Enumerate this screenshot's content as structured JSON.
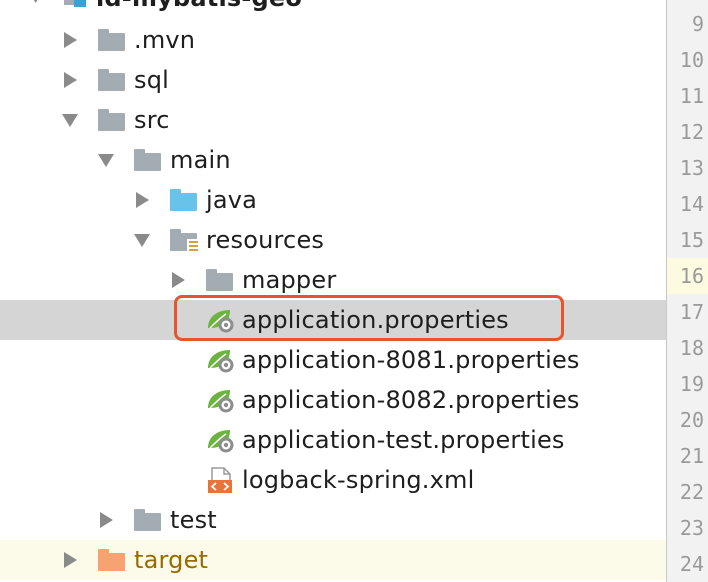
{
  "project": {
    "root_label": "ld-mybatis-geo"
  },
  "tree": [
    {
      "label": ".mvn",
      "kind": "folder-gray",
      "arrow": "right",
      "indent": 0
    },
    {
      "label": "sql",
      "kind": "folder-gray",
      "arrow": "right",
      "indent": 0
    },
    {
      "label": "src",
      "kind": "folder-gray",
      "arrow": "down",
      "indent": 0
    },
    {
      "label": "main",
      "kind": "folder-gray",
      "arrow": "down",
      "indent": 1
    },
    {
      "label": "java",
      "kind": "folder-blue",
      "arrow": "right",
      "indent": 2
    },
    {
      "label": "resources",
      "kind": "folder-resources",
      "arrow": "down",
      "indent": 2
    },
    {
      "label": "mapper",
      "kind": "folder-gray",
      "arrow": "right",
      "indent": 3
    },
    {
      "label": "application.properties",
      "kind": "spring-properties",
      "arrow": "none",
      "indent": 3,
      "selected": true
    },
    {
      "label": "application-8081.properties",
      "kind": "spring-properties",
      "arrow": "none",
      "indent": 3
    },
    {
      "label": "application-8082.properties",
      "kind": "spring-properties",
      "arrow": "none",
      "indent": 3
    },
    {
      "label": "application-test.properties",
      "kind": "spring-properties",
      "arrow": "none",
      "indent": 3
    },
    {
      "label": "logback-spring.xml",
      "kind": "xml-file",
      "arrow": "none",
      "indent": 3
    },
    {
      "label": "test",
      "kind": "folder-gray",
      "arrow": "right",
      "indent": 1
    },
    {
      "label": "target",
      "kind": "folder-orange",
      "arrow": "right",
      "indent": 0,
      "excluded": true
    }
  ],
  "gutter": {
    "line_numbers": [
      "9",
      "10",
      "11",
      "12",
      "13",
      "14",
      "15",
      "16",
      "17",
      "18",
      "19",
      "20",
      "21",
      "22",
      "23",
      "24"
    ],
    "current_line": "16"
  },
  "colors": {
    "selection_bg": "#d5d5d5",
    "highlight_box": "#e8542b",
    "folder_gray": "#a4acb3",
    "folder_source": "#69c2e9",
    "folder_excluded": "#f7a371",
    "spring_green": "#6db33f",
    "excluded_text": "#996b00"
  }
}
